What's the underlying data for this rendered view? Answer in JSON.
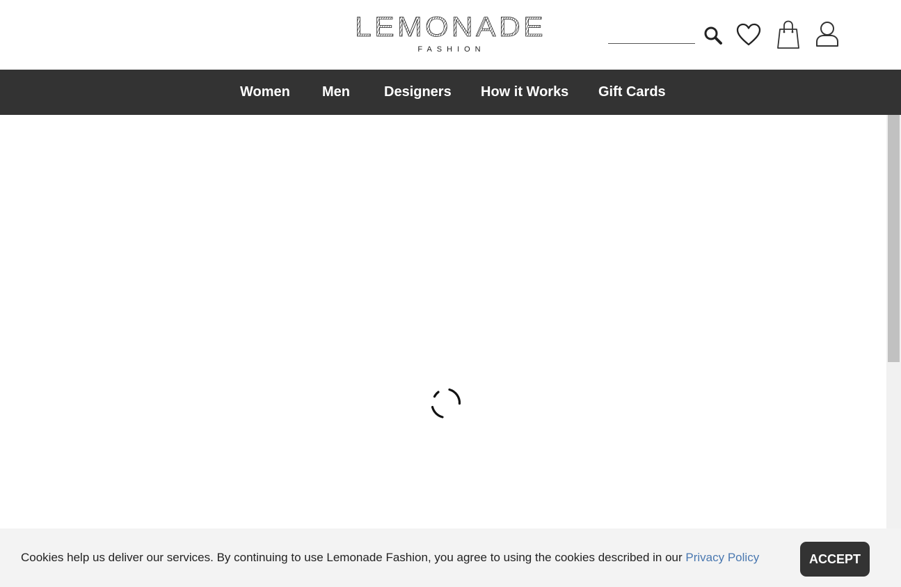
{
  "header": {
    "logo": {
      "wordmark": "LEMONADE",
      "subtitle": "FASHION"
    },
    "search": {
      "value": "",
      "placeholder": "",
      "icon": "search-icon"
    },
    "icons": [
      "search-icon",
      "heart-icon",
      "shopping-bag-icon",
      "user-icon"
    ]
  },
  "nav": {
    "items": [
      {
        "label": "Women"
      },
      {
        "label": "Men"
      },
      {
        "label": "Designers"
      },
      {
        "label": "How it Works"
      },
      {
        "label": "Gift Cards"
      }
    ]
  },
  "main": {
    "state": "loading",
    "spinner_icon": "loading-spinner-icon"
  },
  "cookie_banner": {
    "message": "Cookies help us deliver our services. By continuing to use Lemonade Fashion, you agree to using the cookies described in our ",
    "link_label": "Privacy Policy",
    "accept_label": "ACCEPT"
  },
  "colors": {
    "nav_background": "#333333",
    "nav_text": "#ffffff",
    "banner_background": "#f3f3f3",
    "link": "#4a78b0",
    "button_background": "#333333"
  }
}
